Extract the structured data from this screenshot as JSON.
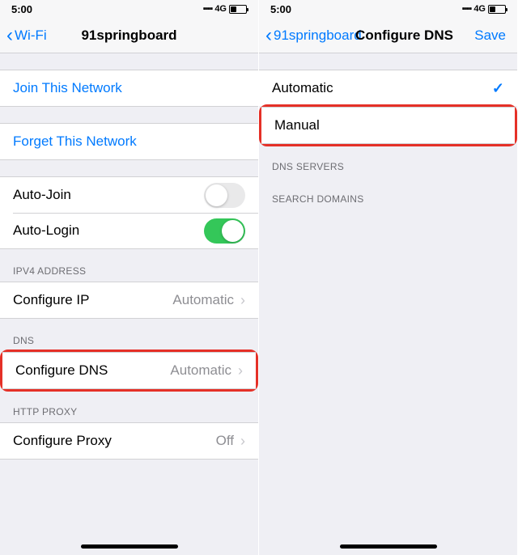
{
  "status": {
    "time": "5:00",
    "net": "4G"
  },
  "left": {
    "nav": {
      "back": "Wi-Fi",
      "title": "91springboard"
    },
    "join": "Join This Network",
    "forget": "Forget This Network",
    "autoJoin": {
      "label": "Auto-Join",
      "on": false
    },
    "autoLogin": {
      "label": "Auto-Login",
      "on": true
    },
    "ipv4": {
      "header": "IPV4 ADDRESS",
      "configureIp": "Configure IP",
      "configureIpVal": "Automatic"
    },
    "dns": {
      "header": "DNS",
      "configureDns": "Configure DNS",
      "configureDnsVal": "Automatic"
    },
    "proxy": {
      "header": "HTTP PROXY",
      "configureProxy": "Configure Proxy",
      "configureProxyVal": "Off"
    }
  },
  "right": {
    "nav": {
      "back": "91springboard",
      "title": "Configure DNS",
      "save": "Save"
    },
    "automatic": "Automatic",
    "manual": "Manual",
    "serversHeader": "DNS SERVERS",
    "searchHeader": "SEARCH DOMAINS"
  }
}
